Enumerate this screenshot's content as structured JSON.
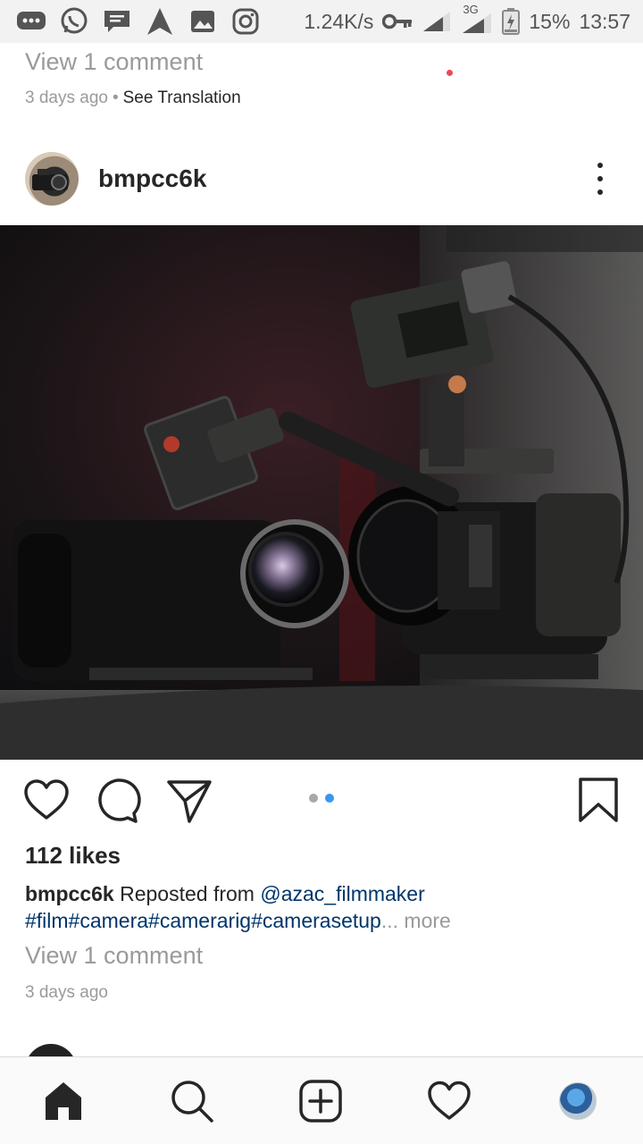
{
  "status_bar": {
    "net_speed": "1.24K/s",
    "network_type": "3G",
    "battery": "15%",
    "time": "13:57",
    "icons": [
      "messages-icon",
      "whatsapp-icon",
      "chat-icon",
      "navigation-icon",
      "gallery-icon",
      "instagram-icon",
      "vpn-key-icon",
      "signal-icon",
      "battery-icon"
    ]
  },
  "previous_post": {
    "view_comments": "View 1 comment",
    "time": "3 days ago",
    "separator": "•",
    "see_translation": "See Translation"
  },
  "post": {
    "username": "bmpcc6k",
    "likes": "112 likes",
    "caption_user": "bmpcc6k",
    "caption_text": "Reposted from",
    "caption_mention": "@azac_filmmaker",
    "caption_tags": "#film#camera#camerarig#camerasetup",
    "more_label": "... more",
    "view_comments": "View 1 comment",
    "time": "3 days ago",
    "carousel": {
      "count": 2,
      "active": 2
    },
    "colors": {
      "active_dot": "#3897f0",
      "inactive_dot": "#a8a8a8",
      "link": "#003569"
    }
  },
  "bottom_nav": {
    "items": [
      "home-icon",
      "search-icon",
      "new-post-icon",
      "activity-icon",
      "profile-icon"
    ],
    "activity_badge_color": "#ed4956"
  }
}
